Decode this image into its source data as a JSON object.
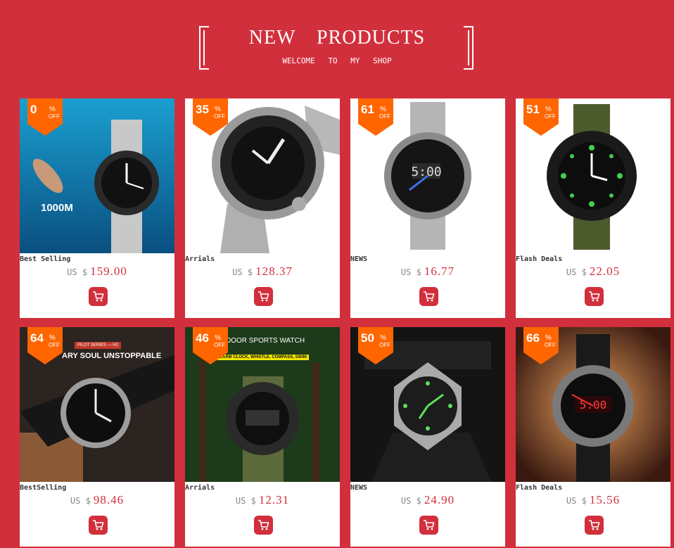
{
  "header": {
    "title": "NEW PRODUCTS",
    "subtitle": "WELCOME TO MY SHOP"
  },
  "colors": {
    "background": "#d22f3c",
    "badge": "#ff6600",
    "price": "#d22f3c",
    "card": "#ffffff"
  },
  "products": [
    {
      "discount": "0",
      "percent_sign": "%",
      "off_label": "OFF",
      "category": "Best Selling",
      "currency": "US $",
      "price": "159.00",
      "watermark": "1000M",
      "icon": "cart-icon"
    },
    {
      "discount": "35",
      "percent_sign": "%",
      "off_label": "OFF",
      "category": "Arrials",
      "currency": "US $",
      "price": "128.37",
      "icon": "cart-icon"
    },
    {
      "discount": "61",
      "percent_sign": "%",
      "off_label": "OFF",
      "category": "NEWS",
      "currency": "US $",
      "price": "16.77",
      "icon": "cart-icon"
    },
    {
      "discount": "51",
      "percent_sign": "%",
      "off_label": "OFF",
      "category": "Flash Deals",
      "currency": "US $",
      "price": "22.05",
      "icon": "cart-icon"
    },
    {
      "discount": "64",
      "percent_sign": "%",
      "off_label": "OFF",
      "category": "BestSelling",
      "currency": "US $",
      "price": "98.46",
      "banner_small": "PILOT SERIES — H2",
      "banner_text": "ARY SOUL UNSTOPPABLE",
      "icon": "cart-icon"
    },
    {
      "discount": "46",
      "percent_sign": "%",
      "off_label": "OFF",
      "category": "Arrials",
      "currency": "US $",
      "price": "12.31",
      "banner_text": "DOOR SPORTS WATCH",
      "banner_small": "ALARM CLOCK, WHISTLE, COMPASS, SWIM",
      "icon": "cart-icon"
    },
    {
      "discount": "50",
      "percent_sign": "%",
      "off_label": "OFF",
      "category": "NEWS",
      "currency": "US $",
      "price": "24.90",
      "icon": "cart-icon"
    },
    {
      "discount": "66",
      "percent_sign": "%",
      "off_label": "OFF",
      "category": "Flash Deals",
      "currency": "US $",
      "price": "15.56",
      "icon": "cart-icon"
    }
  ]
}
